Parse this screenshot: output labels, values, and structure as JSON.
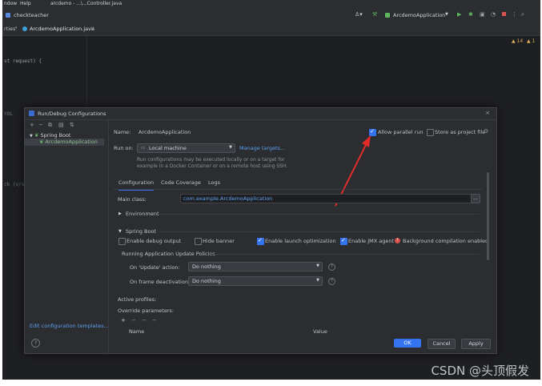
{
  "menu": {
    "items": [
      "ndow",
      "Help"
    ],
    "path": "arcdemo - ...\\...Controller.java"
  },
  "navbar": {
    "project": "checkteacher",
    "run_config": "ArcdemoApplication"
  },
  "tabs": {
    "left": "rties",
    "file": "ArcdemoApplication.java"
  },
  "editor": {
    "code": "st request) {",
    "side1": "YOL",
    "side2": "ck (v/s",
    "warn1": "▲ 14",
    "warn2": "▲ 1"
  },
  "dialog": {
    "title": "Run/Debug Configurations",
    "tree": {
      "group": "Spring Boot",
      "item": "ArcdemoApplication"
    },
    "edit_templates": "Edit configuration templates...",
    "name_label": "Name:",
    "name_value": "ArcdemoApplication",
    "allow_parallel": "Allow parallel run",
    "store_project": "Store as project file",
    "run_on_label": "Run on:",
    "run_on_value": "Local machine",
    "manage_targets": "Manage targets...",
    "run_desc_1": "Run configurations may be executed locally or on a target for",
    "run_desc_2": "example in a Docker Container or on a remote host using SSH.",
    "tabs": [
      "Configuration",
      "Code Coverage",
      "Logs"
    ],
    "main_class_label": "Main class:",
    "main_class_value": "com.example.ArcdemoApplication",
    "environment": "Environment",
    "spring_boot": "Spring Boot",
    "enable_debug": "Enable debug output",
    "hide_banner": "Hide banner",
    "enable_launch": "Enable launch optimization",
    "enable_jmx": "Enable JMX agent",
    "bg_compile": "Background compilation enabled",
    "running_policies": "Running Application Update Policies",
    "on_update_label": "On 'Update' action:",
    "on_update_value": "Do nothing",
    "on_frame_label": "On frame deactivation:",
    "on_frame_value": "Do nothing",
    "active_profiles": "Active profiles:",
    "override_params": "Override parameters:",
    "col_name": "Name",
    "col_value": "Value",
    "ok": "OK",
    "cancel": "Cancel",
    "apply": "Apply"
  },
  "watermark": "CSDN @头顶假发"
}
